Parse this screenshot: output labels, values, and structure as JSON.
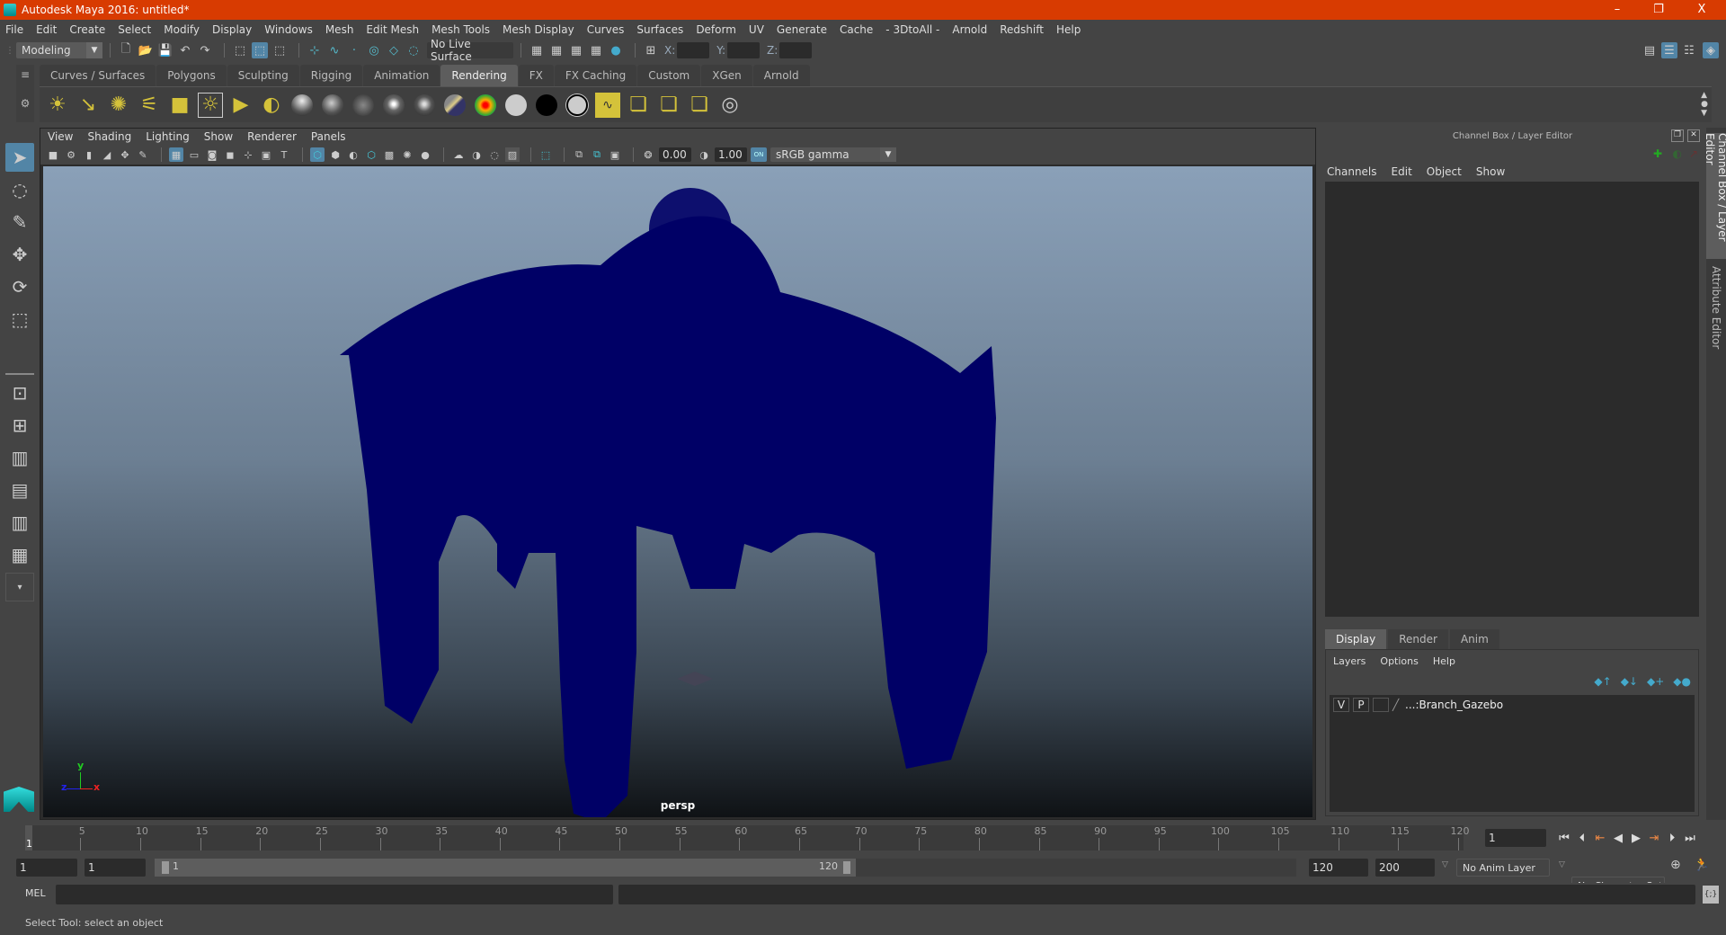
{
  "window": {
    "title": "Autodesk Maya 2016: untitled*",
    "minimize": "–",
    "restore": "❐",
    "close": "X"
  },
  "menubar": [
    "File",
    "Edit",
    "Create",
    "Select",
    "Modify",
    "Display",
    "Windows",
    "Mesh",
    "Edit Mesh",
    "Mesh Tools",
    "Mesh Display",
    "Curves",
    "Surfaces",
    "Deform",
    "UV",
    "Generate",
    "Cache",
    "- 3DtoAll -",
    "Arnold",
    "Redshift",
    "Help"
  ],
  "statusline": {
    "mode": "Modeling",
    "live_surface": "No Live Surface",
    "x_label": "X:",
    "y_label": "Y:",
    "z_label": "Z:",
    "x_value": "",
    "y_value": "",
    "z_value": ""
  },
  "shelf": {
    "tabs": [
      "Curves / Surfaces",
      "Polygons",
      "Sculpting",
      "Rigging",
      "Animation",
      "Rendering",
      "FX",
      "FX Caching",
      "Custom",
      "XGen",
      "Arnold"
    ],
    "active_tab": "Rendering",
    "icons": [
      "ambient-light",
      "directional-light",
      "point-light",
      "spot-light",
      "area-light",
      "volume-light",
      "camera-aim",
      "render-setup",
      "blinn-shader",
      "lambert-shader",
      "phong-shader",
      "phong-e-shader",
      "anisotropic-shader",
      "ramp-shader",
      "layered-shader",
      "surface-shader-grey",
      "surface-shader-black",
      "surface-shader-white",
      "hypershade",
      "render-view",
      "render-current",
      "ipr-render",
      "render-settings"
    ]
  },
  "viewport": {
    "menu": [
      "View",
      "Shading",
      "Lighting",
      "Show",
      "Renderer",
      "Panels"
    ],
    "exposure": "0.00",
    "gamma": "1.00",
    "color_mgmt": "ON",
    "color_space": "sRGB gamma",
    "camera_label": "persp",
    "axis": {
      "x": "x",
      "y": "y",
      "z": "z"
    }
  },
  "channel_box": {
    "title": "Channel Box / Layer Editor",
    "menu": [
      "Channels",
      "Edit",
      "Object",
      "Show"
    ]
  },
  "layer_editor": {
    "tabs": [
      "Display",
      "Render",
      "Anim"
    ],
    "active_tab": "Display",
    "menu": [
      "Layers",
      "Options",
      "Help"
    ],
    "layers": [
      {
        "v": "V",
        "p": "P",
        "name": "...:Branch_Gazebo"
      }
    ]
  },
  "side_tabs": [
    "Channel Box / Layer Editor",
    "Attribute Editor"
  ],
  "timeline": {
    "ticks": [
      5,
      10,
      15,
      20,
      25,
      30,
      35,
      40,
      45,
      50,
      55,
      60,
      65,
      70,
      75,
      80,
      85,
      90,
      95,
      100,
      105,
      110,
      115,
      120
    ],
    "current_frame": "1",
    "frame_field": "1",
    "range_start": "1",
    "playback_start": "1",
    "slider_start": "1",
    "slider_end": "120",
    "playback_end": "120",
    "range_end": "200",
    "anim_layer": "No Anim Layer",
    "character_set": "No Character Set"
  },
  "command_line": {
    "label": "MEL",
    "value": ""
  },
  "help_line": "Select Tool: select an object",
  "colors": {
    "title_bar": "#d83b01",
    "accent": "#5285a6",
    "model": "#000066",
    "shelf_icon": "#d4c23a"
  }
}
